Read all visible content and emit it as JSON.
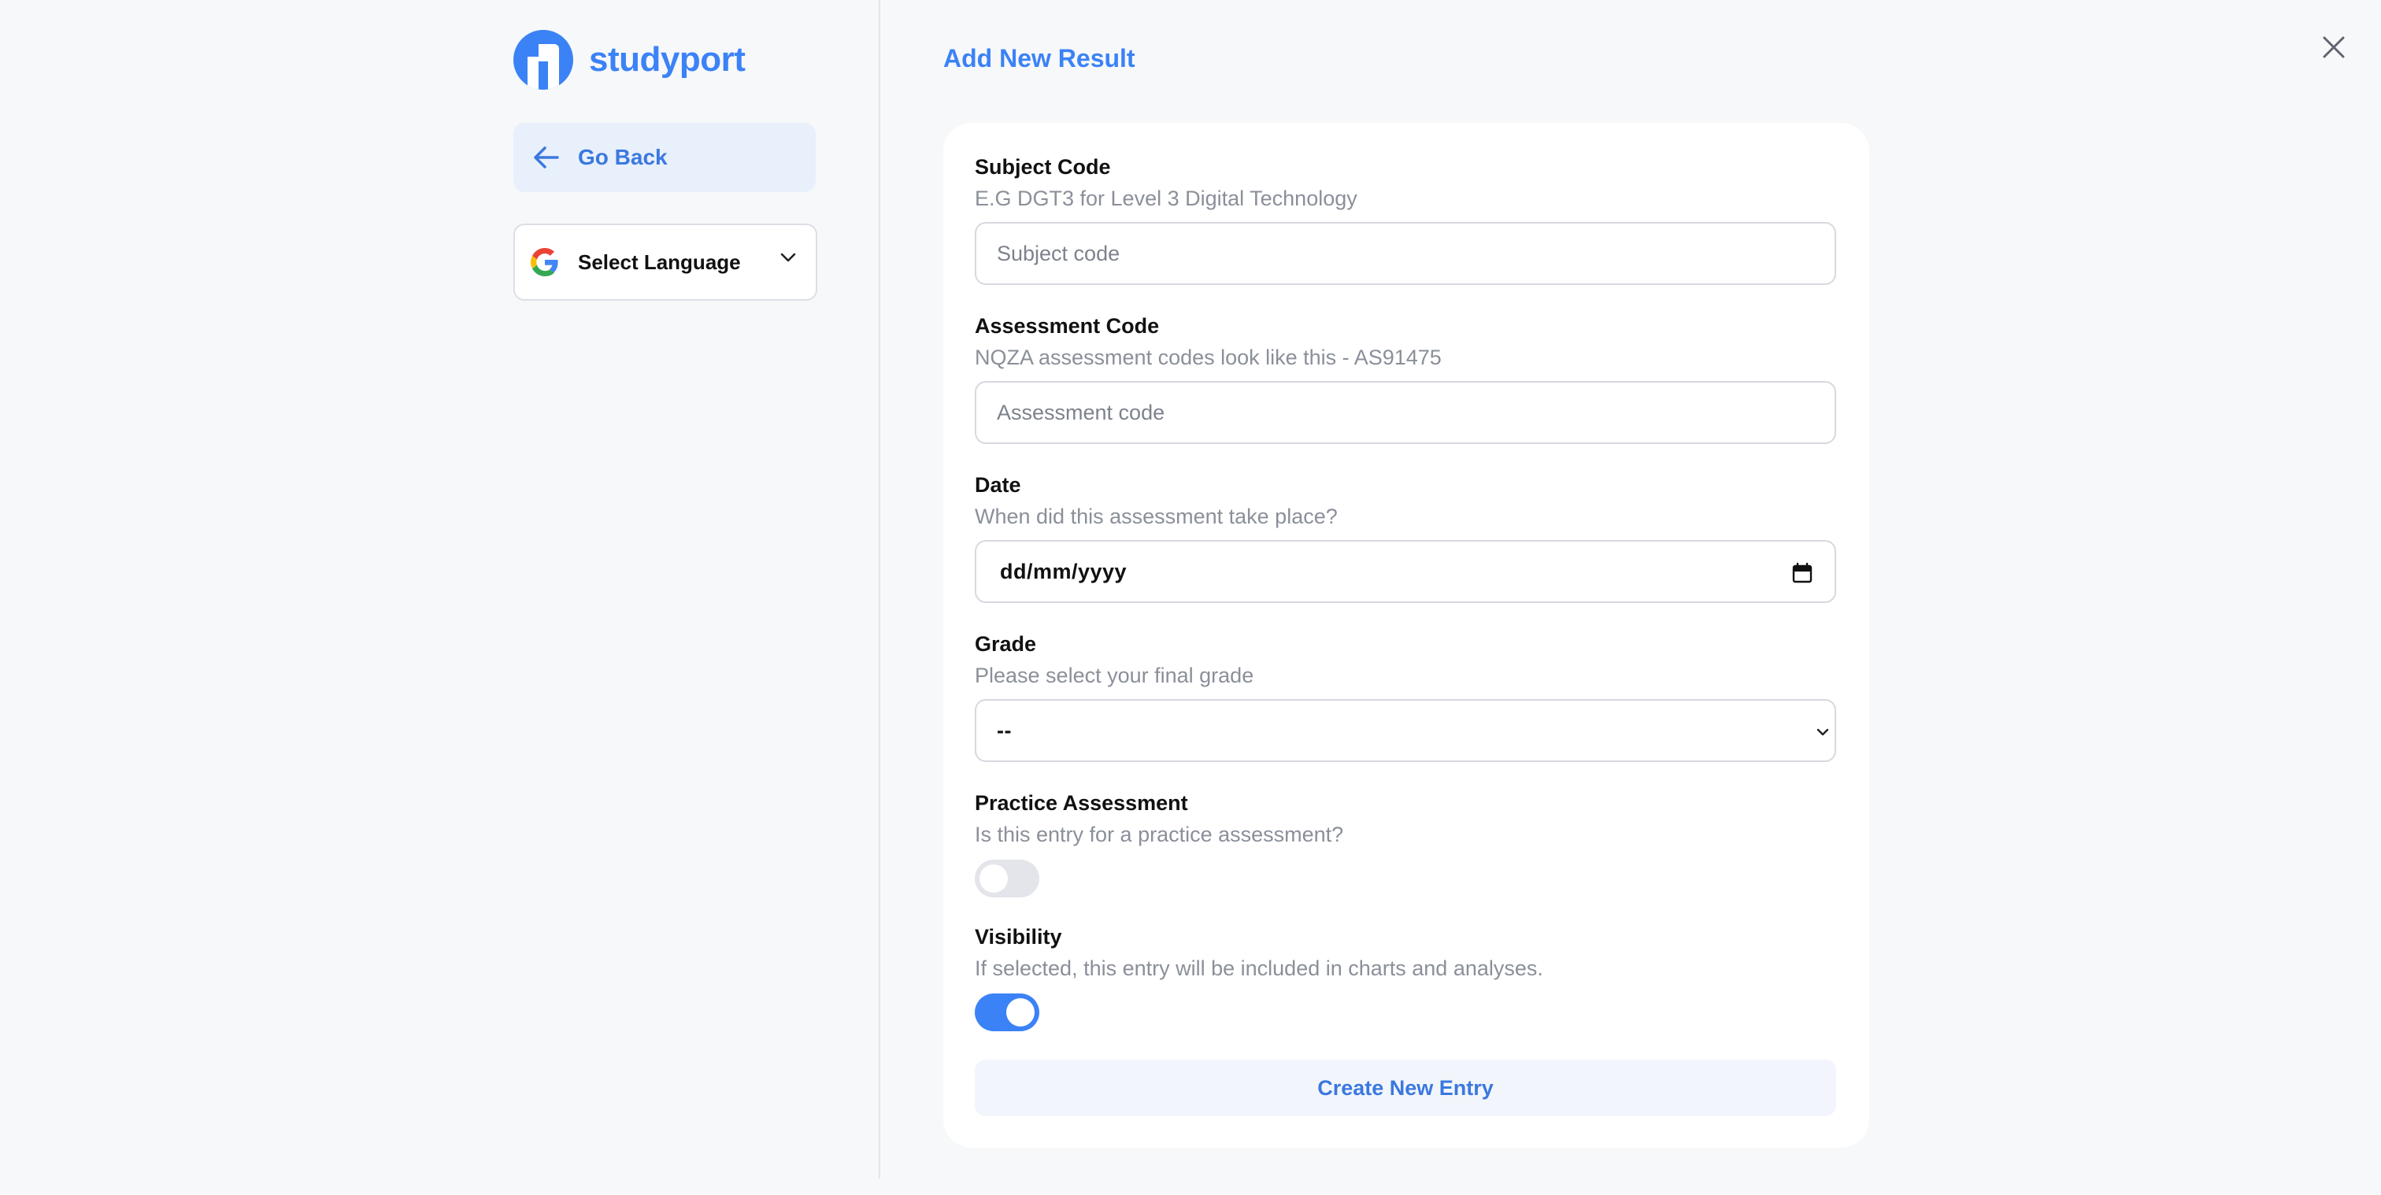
{
  "brand": {
    "name": "studyport",
    "accent": "#3b82f6"
  },
  "sidebar": {
    "go_back_label": "Go Back",
    "language": {
      "label": "Select Language",
      "icon": "google-icon"
    }
  },
  "page": {
    "title": "Add New Result",
    "close_icon": "close-icon"
  },
  "form": {
    "subject": {
      "label": "Subject Code",
      "help": "E.G DGT3 for Level 3 Digital Technology",
      "placeholder": "Subject code",
      "value": ""
    },
    "assessment": {
      "label": "Assessment Code",
      "help": "NQZA assessment codes look like this - AS91475",
      "placeholder": "Assessment code",
      "value": ""
    },
    "date": {
      "label": "Date",
      "help": "When did this assessment take place?",
      "placeholder": "dd/mm/yyyy"
    },
    "grade": {
      "label": "Grade",
      "help": "Please select your final grade",
      "selected": "--"
    },
    "practice": {
      "label": "Practice Assessment",
      "help": "Is this entry for a practice assessment?",
      "enabled": false
    },
    "visibility": {
      "label": "Visibility",
      "help": "If selected, this entry will be included in charts and analyses.",
      "enabled": true
    },
    "submit_label": "Create New Entry"
  }
}
